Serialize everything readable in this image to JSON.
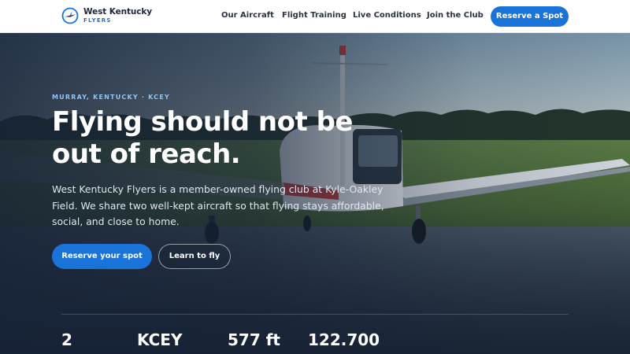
{
  "brand": {
    "name": "West Kentucky",
    "sub": "FLYERS"
  },
  "nav": {
    "items": [
      "Our Aircraft",
      "Flight Training",
      "Live Conditions",
      "Join the Club"
    ],
    "cta": "Reserve a Spot"
  },
  "hero": {
    "eyebrow": "MURRAY, KENTUCKY · KCEY",
    "headline": "Flying should not be out of reach.",
    "lede": "West Kentucky Flyers is a member-owned flying club at Kyle-Oakley Field. We share two well-kept aircraft so that flying stays affordable, social, and close to home.",
    "primary_cta": "Reserve your spot",
    "secondary_cta": "Learn to fly"
  },
  "stats": [
    "2",
    "KCEY",
    "577 ft",
    "122.700"
  ],
  "colors": {
    "accent": "#1a73d9",
    "eyebrow": "#8ec4f5",
    "ink": "#1b2636",
    "hero_overlay": "#162236"
  },
  "icons": {
    "logo": "compass-wing-icon"
  }
}
